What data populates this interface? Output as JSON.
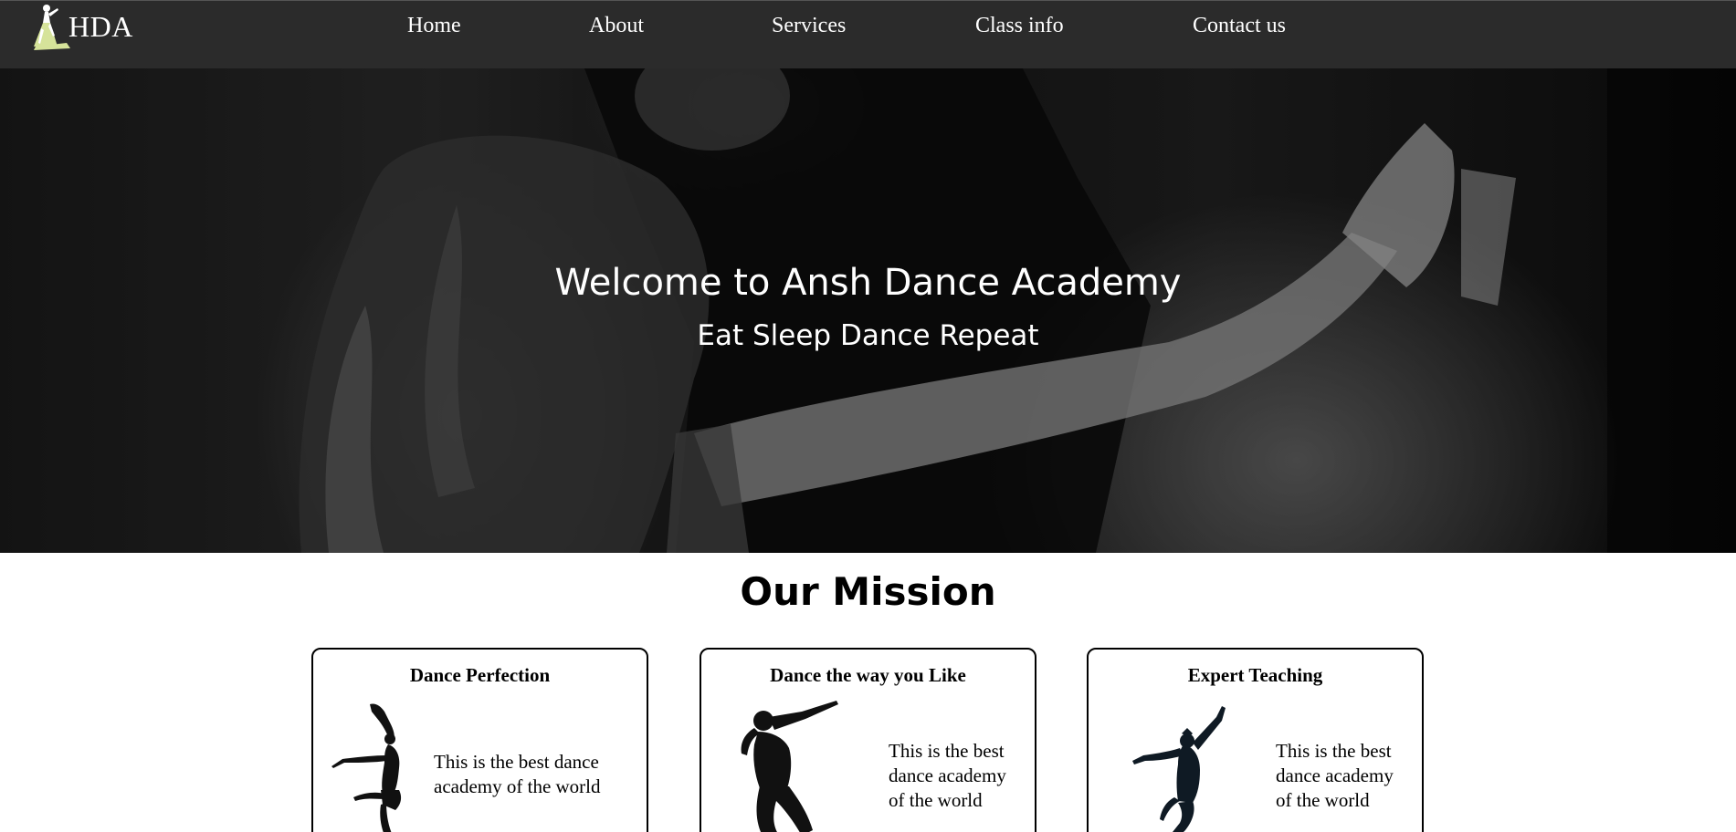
{
  "nav": {
    "logo_text": "HDA",
    "links": [
      {
        "label": "Home"
      },
      {
        "label": "About"
      },
      {
        "label": "Services"
      },
      {
        "label": "Class info"
      },
      {
        "label": "Contact us"
      }
    ]
  },
  "hero": {
    "title": "Welcome to Ansh Dance Academy",
    "subtitle": "Eat Sleep Dance Repeat"
  },
  "mission": {
    "heading": "Our Mission",
    "cards": [
      {
        "title": "Dance Perfection",
        "text": "This is the best dance academy of the world",
        "icon": "ballet-dancer-silhouette"
      },
      {
        "title": "Dance the way you Like",
        "text": "This is the best dance academy of the world",
        "icon": "hiphop-dancer-silhouette"
      },
      {
        "title": "Expert Teaching",
        "text": "This is the best dance academy of the world",
        "icon": "jumping-dancer-silhouette"
      }
    ]
  },
  "colors": {
    "navbar_bg": "#2b2b2b",
    "logo_accent": "#d6e39a",
    "text_light": "#ffffff",
    "text_dark": "#000000"
  }
}
